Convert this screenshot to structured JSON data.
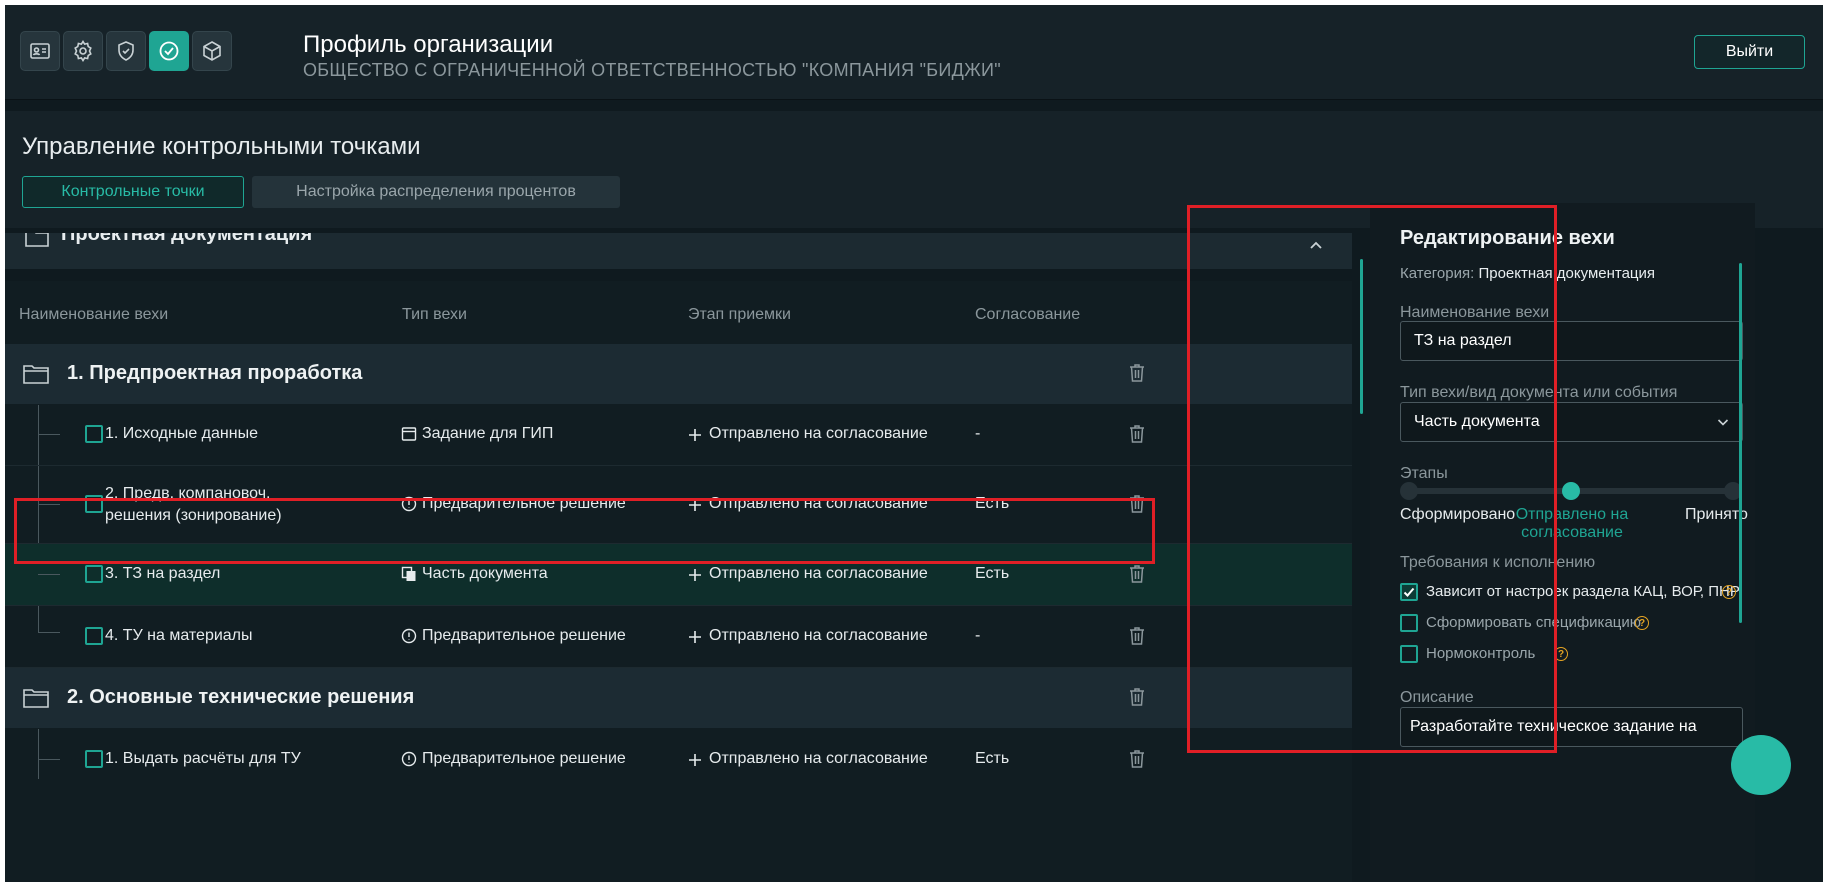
{
  "header": {
    "icons": [
      "id-card-icon",
      "gear-icon",
      "shield-check-icon",
      "check-circle-icon",
      "cube-icon"
    ],
    "title": "Профиль организации",
    "subtitle": "ОБЩЕСТВО С ОГРАНИЧЕННОЙ ОТВЕТСТВЕННОСТЬЮ \"КОМПАНИЯ \"БИДЖИ\"",
    "exit_label": "Выйти"
  },
  "page": {
    "title": "Управление контрольными точками",
    "tabs": [
      {
        "label": "Контрольные точки",
        "active": true
      },
      {
        "label": "Настройка распределения процентов",
        "active": false
      }
    ]
  },
  "category": {
    "name": "Проектная документация"
  },
  "table": {
    "headers": [
      "Наименование вехи",
      "Тип вехи",
      "Этап приемки",
      "Согласование"
    ],
    "groups": [
      {
        "label": "1. Предпроектная проработка",
        "rows": [
          {
            "name": "1. Исходные данные",
            "type": "Задание для ГИП",
            "type_icon": "window-icon",
            "stage": "Отправлено на согласование",
            "approval": "-"
          },
          {
            "name": "2. Предв. компановоч. решения (зонирование)",
            "type": "Предварительное решение",
            "type_icon": "alert-circle-icon",
            "stage": "Отправлено на согласование",
            "approval": "Есть"
          },
          {
            "name": "3. ТЗ на раздел",
            "type": "Часть документа",
            "type_icon": "documents-icon",
            "stage": "Отправлено на согласование",
            "approval": "Есть",
            "selected": true
          },
          {
            "name": "4. ТУ на материалы",
            "type": "Предварительное решение",
            "type_icon": "alert-circle-icon",
            "stage": "Отправлено на согласование",
            "approval": "-"
          }
        ]
      },
      {
        "label": "2. Основные технические решения",
        "rows": [
          {
            "name": "1. Выдать расчёты для ТУ",
            "type": "Предварительное решение",
            "type_icon": "alert-circle-icon",
            "stage": "Отправлено на согласование",
            "approval": "Есть"
          }
        ]
      }
    ]
  },
  "editor": {
    "title": "Редактирование вехи",
    "category_label": "Категория:",
    "category_value": "Проектная документация",
    "name_label": "Наименование вехи",
    "name_value": "ТЗ на раздел",
    "type_label": "Тип вехи/вид документа или события",
    "type_value": "Часть документа",
    "stages_label": "Этапы",
    "stages": [
      {
        "label": "Сформировано",
        "active": false
      },
      {
        "label": "Отправлено на согласование",
        "active": true
      },
      {
        "label": "Принято",
        "active": false
      }
    ],
    "requirements_label": "Требования к исполнению",
    "requirements": [
      {
        "label": "Зависит от настроек раздела КАЦ, ВОР, ПНР",
        "checked": true,
        "help": true
      },
      {
        "label": "Сформировать спецификацию",
        "checked": false,
        "help": true
      },
      {
        "label": "Нормоконтроль",
        "checked": false,
        "help": true
      }
    ],
    "description_label": "Описание",
    "description_value": "Разработайте техническое задание на"
  },
  "colors": {
    "accent": "#1fa593",
    "highlight": "#e01f26",
    "help": "#e5a423",
    "background": "#0f1a1f"
  }
}
